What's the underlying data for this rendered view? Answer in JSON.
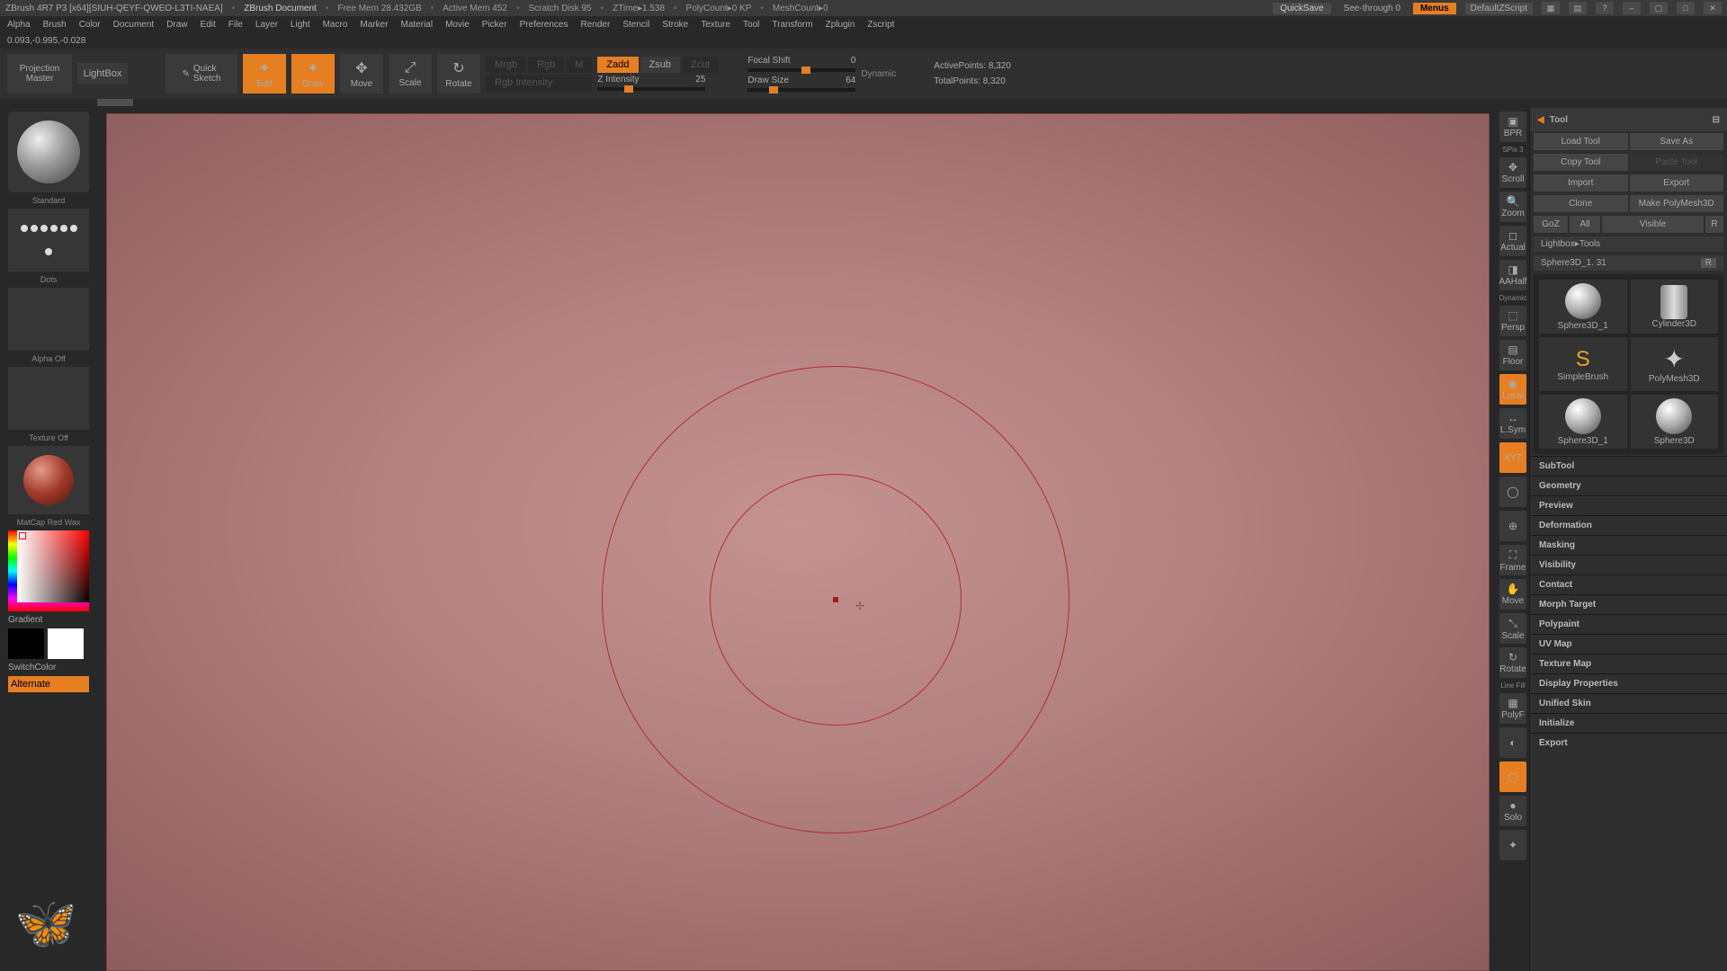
{
  "titlebar": {
    "app": "ZBrush 4R7 P3 [x64][SIUH-QEYF-QWEO-L3TI-NAEA]",
    "doc": "ZBrush Document",
    "mem": "Free Mem 28.432GB",
    "amem": "Active Mem 452",
    "scratch": "Scratch Disk 95",
    "ztime": "ZTime▸1.538",
    "poly": "PolyCount▸0 KP",
    "mesh": "MeshCount▸0",
    "quicksave": "QuickSave",
    "seethru": "See-through  0",
    "menus": "Menus",
    "script": "DefaultZScript"
  },
  "menubar": [
    "Alpha",
    "Brush",
    "Color",
    "Document",
    "Draw",
    "Edit",
    "File",
    "Layer",
    "Light",
    "Macro",
    "Marker",
    "Material",
    "Movie",
    "Picker",
    "Preferences",
    "Render",
    "Stencil",
    "Stroke",
    "Texture",
    "Tool",
    "Transform",
    "Zplugin",
    "Zscript"
  ],
  "coord": "0.093,-0.995,-0.028",
  "shelf": {
    "proj1": "Projection",
    "proj2": "Master",
    "lightbox": "LightBox",
    "qsketch1": "Quick",
    "qsketch2": "Sketch",
    "edit": "Edit",
    "draw": "Draw",
    "move": "Move",
    "scale": "Scale",
    "rotate": "Rotate",
    "mrgb": "Mrgb",
    "rgb": "Rgb",
    "m": "M",
    "rgbint": "Rgb Intensity",
    "zadd": "Zadd",
    "zsub": "Zsub",
    "zcut": "Zcut",
    "zint_l": "Z Intensity",
    "zint_v": "25",
    "focal_l": "Focal Shift",
    "focal_v": "0",
    "draw_l": "Draw Size",
    "draw_v": "64",
    "dyn": "Dynamic",
    "ap_l": "ActivePoints:",
    "ap_v": "8,320",
    "tp_l": "TotalPoints:",
    "tp_v": "8,320"
  },
  "left": {
    "brush": "Standard",
    "stroke": "Dots",
    "alpha": "Alpha Off",
    "tex": "Texture Off",
    "mat": "MatCap Red Wax",
    "grad": "Gradient",
    "switch": "SwitchColor",
    "alt": "Alternate"
  },
  "rstrip": {
    "bpr": "BPR",
    "spix": "SPix 3",
    "scroll": "Scroll",
    "zoom": "Zoom",
    "actual": "Actual",
    "aahalf": "AAHalf",
    "persp": "Persp",
    "floor": "Floor",
    "local": "Local",
    "lsym": "L.Sym",
    "circ": "",
    "pan": "",
    "frame": "Frame",
    "move": "Move",
    "scale": "Scale",
    "rotate": "Rotate",
    "xyz": "XYZ",
    "linefill": "Line Fill",
    "polyf": "PolyF",
    "transp": "",
    "dynamic": "Dynamic",
    "solo": "Solo",
    "pframe": ""
  },
  "rpanel": {
    "title": "Tool",
    "loadtool": "Load Tool",
    "saveas": "Save As",
    "copytool": "Copy Tool",
    "pastetool": "Paste Tool",
    "import": "Import",
    "export": "Export",
    "clone": "Clone",
    "makepm": "Make PolyMesh3D",
    "goz": "GoZ",
    "all": "All",
    "visible": "Visible",
    "r": "R",
    "lbtools": "Lightbox▸Tools",
    "toolname": "Sphere3D_1. 31",
    "th_sphere": "Sphere3D_1",
    "th_cyl": "Cylinder3D",
    "th_star": "PolyMesh3D",
    "th_sb": "SimpleBrush",
    "th_sp3d": "Sphere3D",
    "th_s1": "Sphere3D_1",
    "subs": [
      "SubTool",
      "Geometry",
      "Preview",
      "Deformation",
      "Masking",
      "Visibility",
      "Contact",
      "Morph Target",
      "Polypaint",
      "UV Map",
      "Texture Map",
      "Display Properties",
      "Unified Skin",
      "Initialize",
      "Export"
    ]
  }
}
